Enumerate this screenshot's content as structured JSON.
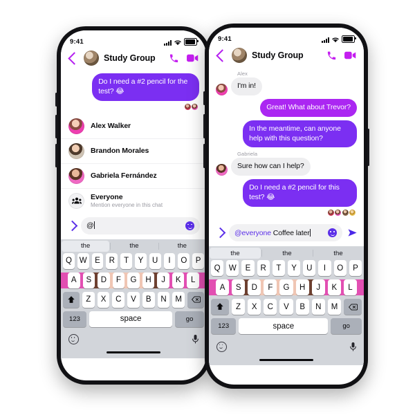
{
  "meta": {
    "scene": "Two iPhone mockups showing a group chat mention flow in a messaging app",
    "accent_magenta": "#ab27f2",
    "accent_violet": "#7b2ff2",
    "accent_link": "#5b2fe8",
    "header_icon_color": "#c41ef0",
    "bubble_in_bg": "#eeeef0",
    "keyboard_bg": "#d2d5da"
  },
  "status_bar": {
    "time": "9:41",
    "signal_icon": "cellular-bars-icon",
    "wifi_icon": "wifi-icon",
    "battery_icon": "battery-icon"
  },
  "header": {
    "back_icon": "back-chevron-icon",
    "avatar": "group-avatar",
    "title": "Study Group",
    "call_icon": "phone-call-icon",
    "video_icon": "video-call-icon"
  },
  "left_phone": {
    "messages": [
      {
        "id": "m1",
        "direction": "out",
        "style": "violet",
        "text": "Do I need a #2 pencil for the test? 😂"
      }
    ],
    "receipts": [
      "read-avatar-1",
      "read-avatar-2"
    ],
    "mention_list": [
      {
        "name": "Alex Walker",
        "sub": "",
        "avatar": "avatar-alex-walker"
      },
      {
        "name": "Brandon Morales",
        "sub": "",
        "avatar": "avatar-brandon-morales"
      },
      {
        "name": "Gabriela Fernández",
        "sub": "",
        "avatar": "avatar-gabriela-fernandez"
      },
      {
        "name": "Everyone",
        "sub": "Mention everyone in this chat",
        "avatar": "group-people-icon"
      }
    ],
    "composer": {
      "expand_icon": "chevron-right-icon",
      "mention_text": "",
      "value": "@",
      "placeholder": "Aa",
      "emoji_icon": "emoji-sticker-icon",
      "send_icon": "send-arrow-icon"
    },
    "keyboard": {
      "suggestions": [
        "the",
        "the",
        "the"
      ],
      "row1": [
        "Q",
        "W",
        "E",
        "R",
        "T",
        "Y",
        "U",
        "I",
        "O",
        "P"
      ],
      "row2": [
        "A",
        "S",
        "D",
        "F",
        "G",
        "H",
        "J",
        "K",
        "L"
      ],
      "row3": [
        "Z",
        "X",
        "C",
        "V",
        "B",
        "N",
        "M"
      ],
      "shift_icon": "shift-key-icon",
      "backspace_icon": "backspace-key-icon",
      "numeric_label": "123",
      "space_label": "space",
      "return_label": "go",
      "emoji_icon": "keyboard-emoji-icon",
      "mic_icon": "microphone-icon"
    }
  },
  "right_phone": {
    "messages": [
      {
        "id": "r1",
        "direction": "in",
        "style": "in",
        "sender": "Alex",
        "text": "I'm in!"
      },
      {
        "id": "r2",
        "direction": "out",
        "style": "magenta",
        "sender": "",
        "text": "Great! What about Trevor?"
      },
      {
        "id": "r3",
        "direction": "out",
        "style": "violet",
        "sender": "",
        "text": "In the meantime, can anyone help with this question?"
      },
      {
        "id": "r4",
        "direction": "in",
        "style": "in",
        "sender": "Gabriela",
        "text": "Sure how can I help?"
      },
      {
        "id": "r5",
        "direction": "out",
        "style": "violet",
        "sender": "",
        "text": "Do I need a #2 pencil for this test? 😂"
      }
    ],
    "receipts": [
      "read-avatar-1",
      "read-avatar-2",
      "read-avatar-3",
      "read-avatar-4"
    ],
    "composer": {
      "expand_icon": "chevron-right-icon",
      "mention_text": "@everyone",
      "value": " Coffee later",
      "placeholder": "Aa",
      "emoji_icon": "emoji-sticker-icon",
      "send_icon": "send-arrow-icon"
    },
    "keyboard": {
      "suggestions": [
        "the",
        "the",
        "the"
      ],
      "row1": [
        "Q",
        "W",
        "E",
        "R",
        "T",
        "Y",
        "U",
        "I",
        "O",
        "P"
      ],
      "row2": [
        "A",
        "S",
        "D",
        "F",
        "G",
        "H",
        "J",
        "K",
        "L"
      ],
      "row3": [
        "Z",
        "X",
        "C",
        "V",
        "B",
        "N",
        "M"
      ],
      "shift_icon": "shift-key-icon",
      "backspace_icon": "backspace-key-icon",
      "numeric_label": "123",
      "space_label": "space",
      "return_label": "go",
      "emoji_icon": "keyboard-emoji-icon",
      "mic_icon": "microphone-icon"
    }
  }
}
